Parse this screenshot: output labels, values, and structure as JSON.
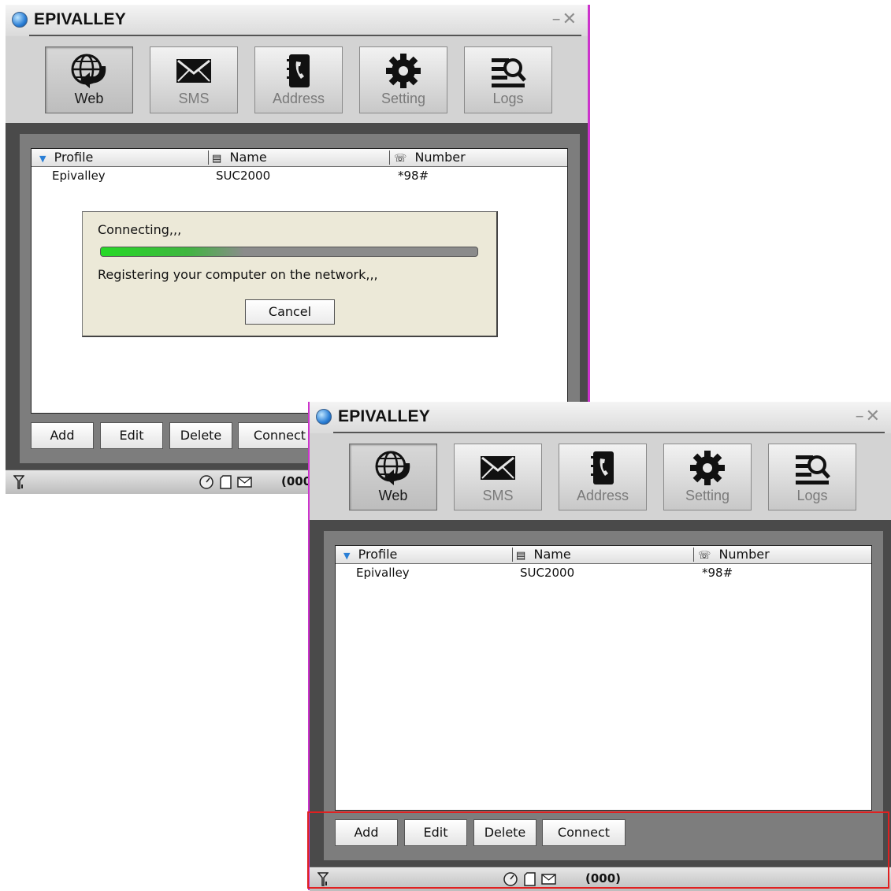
{
  "app": {
    "title": "EPIVALLEY",
    "window_controls": "— ✕"
  },
  "toolbar": {
    "items": [
      {
        "label": "Web",
        "icon": "globe-arrow-icon",
        "active": true
      },
      {
        "label": "SMS",
        "icon": "envelope-icon",
        "active": false
      },
      {
        "label": "Address",
        "icon": "address-book-phone-icon",
        "active": false
      },
      {
        "label": "Setting",
        "icon": "gear-icon",
        "active": false
      },
      {
        "label": "Logs",
        "icon": "logs-magnifier-icon",
        "active": false
      }
    ]
  },
  "list": {
    "columns": [
      {
        "label": "Profile",
        "icon": "sort-down-icon"
      },
      {
        "label": "Name",
        "icon": "card-icon"
      },
      {
        "label": "Number",
        "icon": "phone-icon"
      }
    ],
    "rows": [
      {
        "profile": "Epivalley",
        "name": "SUC2000",
        "number": "*98#"
      }
    ]
  },
  "buttons": {
    "add": "Add",
    "edit": "Edit",
    "delete": "Delete",
    "connect": "Connect"
  },
  "status": {
    "count_full": "(000)",
    "count_clipped": "(000"
  },
  "dialog": {
    "title_text": "Connecting,,,",
    "progress": 0.38,
    "message": "Registering your computer on the network,,,",
    "cancel": "Cancel"
  },
  "colors": {
    "window_border": "#cc33cc",
    "highlight": "#e02020",
    "progress": "#26d926"
  }
}
